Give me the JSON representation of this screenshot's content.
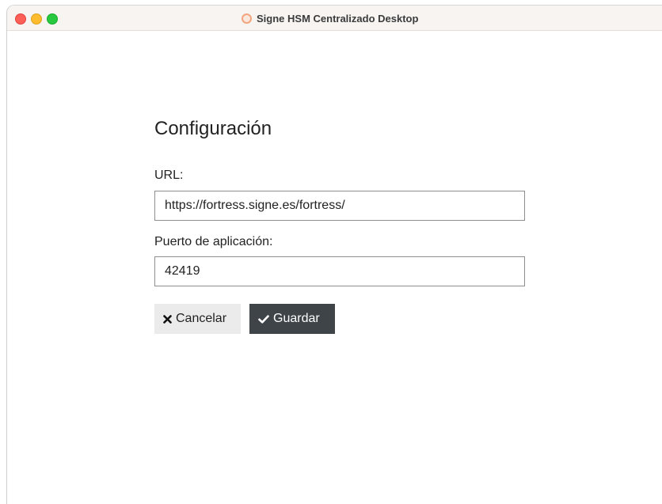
{
  "window": {
    "title": "Signe HSM Centralizado Desktop",
    "app_icon": "ring-icon"
  },
  "form": {
    "heading": "Configuración",
    "url_label": "URL:",
    "url_value": "https://fortress.signe.es/fortress/",
    "port_label": "Puerto de aplicación:",
    "port_value": "42419"
  },
  "actions": {
    "cancel_label": "Cancelar",
    "cancel_icon": "times-icon",
    "save_label": "Guardar",
    "save_icon": "check-icon"
  },
  "colors": {
    "save_button_bg": "#3f4449",
    "cancel_button_bg": "#ebebeb",
    "titlebar_bg": "#f7f4f1"
  }
}
